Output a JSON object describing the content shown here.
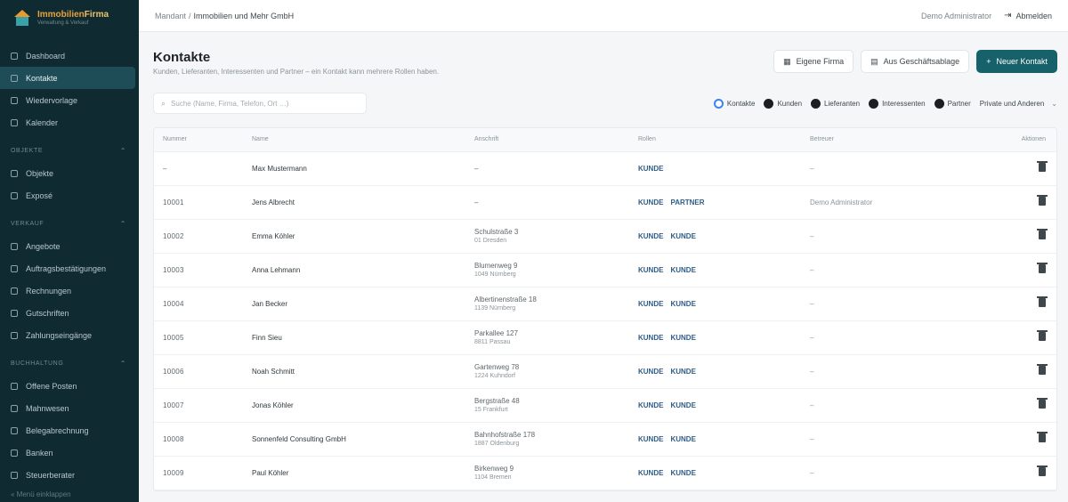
{
  "brand": {
    "name_part1": "Immobilien",
    "name_part2": "Firma",
    "tagline": "Verwaltung & Verkauf"
  },
  "sidebar": {
    "items_top": [
      {
        "label": "Dashboard",
        "icon": "dashboard-icon",
        "active": false
      },
      {
        "label": "Kontakte",
        "icon": "contacts-icon",
        "active": true
      },
      {
        "label": "Wiedervorlage",
        "icon": "reminder-icon",
        "active": false
      },
      {
        "label": "Kalender",
        "icon": "calendar-icon",
        "active": false
      }
    ],
    "section1": {
      "title": "OBJEKTE",
      "items": [
        {
          "label": "Objekte",
          "icon": "building-icon"
        },
        {
          "label": "Exposé",
          "icon": "document-icon"
        }
      ]
    },
    "section2": {
      "title": "VERKAUF",
      "items": [
        {
          "label": "Angebote",
          "icon": "offer-icon"
        },
        {
          "label": "Auftragsbestätigungen",
          "icon": "confirmation-icon"
        },
        {
          "label": "Rechnungen",
          "icon": "invoice-icon"
        },
        {
          "label": "Gutschriften",
          "icon": "credit-icon"
        },
        {
          "label": "Zahlungseingänge",
          "icon": "payment-icon"
        }
      ]
    },
    "section3": {
      "title": "BUCHHALTUNG",
      "items": [
        {
          "label": "Offene Posten",
          "icon": "open-items-icon"
        },
        {
          "label": "Mahnwesen",
          "icon": "dunning-icon"
        },
        {
          "label": "Belegabrechnung",
          "icon": "receipt-icon"
        },
        {
          "label": "Banken",
          "icon": "bank-icon"
        },
        {
          "label": "Steuerberater",
          "icon": "tax-icon"
        }
      ]
    },
    "footer": "Menü einklappen"
  },
  "topbar": {
    "breadcrumb_root": "Mandant",
    "breadcrumb_current": "Immobilien und Mehr GmbH",
    "user": "Demo Administrator",
    "logout": "Abmelden"
  },
  "page": {
    "title": "Kontakte",
    "subtitle": "Kunden, Lieferanten, Interessenten und Partner – ein Kontakt kann mehrere Rollen haben."
  },
  "actions": {
    "own_company": "Eigene Firma",
    "documents": "Aus Geschäftsablage",
    "new_contact": "Neuer Kontakt"
  },
  "search": {
    "placeholder": "Suche (Name, Firma, Telefon, Ort …)"
  },
  "filters": {
    "chips": [
      {
        "label": "Kontakte",
        "checked": true
      },
      {
        "label": "Kunden",
        "checked": false
      },
      {
        "label": "Lieferanten",
        "checked": false
      },
      {
        "label": "Interessenten",
        "checked": false
      },
      {
        "label": "Partner",
        "checked": false
      }
    ],
    "select_value": "Private und Anderen"
  },
  "table": {
    "headers": [
      "Nummer",
      "Name",
      "Anschrift",
      "Rollen",
      "Betreuer",
      "Aktionen"
    ],
    "rows": [
      {
        "number": "–",
        "name": "Max Mustermann",
        "addr1": "–",
        "addr2": "",
        "roles": [
          "KUNDE"
        ],
        "agent": "–"
      },
      {
        "number": "10001",
        "name": "Jens Albrecht",
        "addr1": "–",
        "addr2": "",
        "roles": [
          "KUNDE",
          "PARTNER"
        ],
        "agent": "Demo Administrator"
      },
      {
        "number": "10002",
        "name": "Emma Köhler",
        "addr1": "Schulstraße 3",
        "addr2": "01 Dresden",
        "roles": [
          "KUNDE",
          "KUNDE"
        ],
        "agent": "–"
      },
      {
        "number": "10003",
        "name": "Anna Lehmann",
        "addr1": "Blumenweg 9",
        "addr2": "1049 Nürnberg",
        "roles": [
          "KUNDE",
          "KUNDE"
        ],
        "agent": "–"
      },
      {
        "number": "10004",
        "name": "Jan Becker",
        "addr1": "Albertinenstraße 18",
        "addr2": "1139 Nürnberg",
        "roles": [
          "KUNDE",
          "KUNDE"
        ],
        "agent": "–"
      },
      {
        "number": "10005",
        "name": "Finn Sieu",
        "addr1": "Parkallee 127",
        "addr2": "8811 Passau",
        "roles": [
          "KUNDE",
          "KUNDE"
        ],
        "agent": "–"
      },
      {
        "number": "10006",
        "name": "Noah Schmitt",
        "addr1": "Gartenweg 78",
        "addr2": "1224 Kuhndorf",
        "roles": [
          "KUNDE",
          "KUNDE"
        ],
        "agent": "–"
      },
      {
        "number": "10007",
        "name": "Jonas Köhler",
        "addr1": "Bergstraße 48",
        "addr2": "15 Frankfurt",
        "roles": [
          "KUNDE",
          "KUNDE"
        ],
        "agent": "–"
      },
      {
        "number": "10008",
        "name": "Sonnenfeld Consulting GmbH",
        "addr1": "Bahnhofstraße 178",
        "addr2": "1887 Oldenburg",
        "roles": [
          "KUNDE",
          "KUNDE"
        ],
        "agent": "–"
      },
      {
        "number": "10009",
        "name": "Paul Köhler",
        "addr1": "Birkenweg 9",
        "addr2": "1104 Bremen",
        "roles": [
          "KUNDE",
          "KUNDE"
        ],
        "agent": "–"
      }
    ]
  },
  "colors": {
    "sidebar_bg": "#0f2a31",
    "accent": "#16616a",
    "brand_orange": "#e89a2c",
    "role_tag": "#2f5d86"
  }
}
